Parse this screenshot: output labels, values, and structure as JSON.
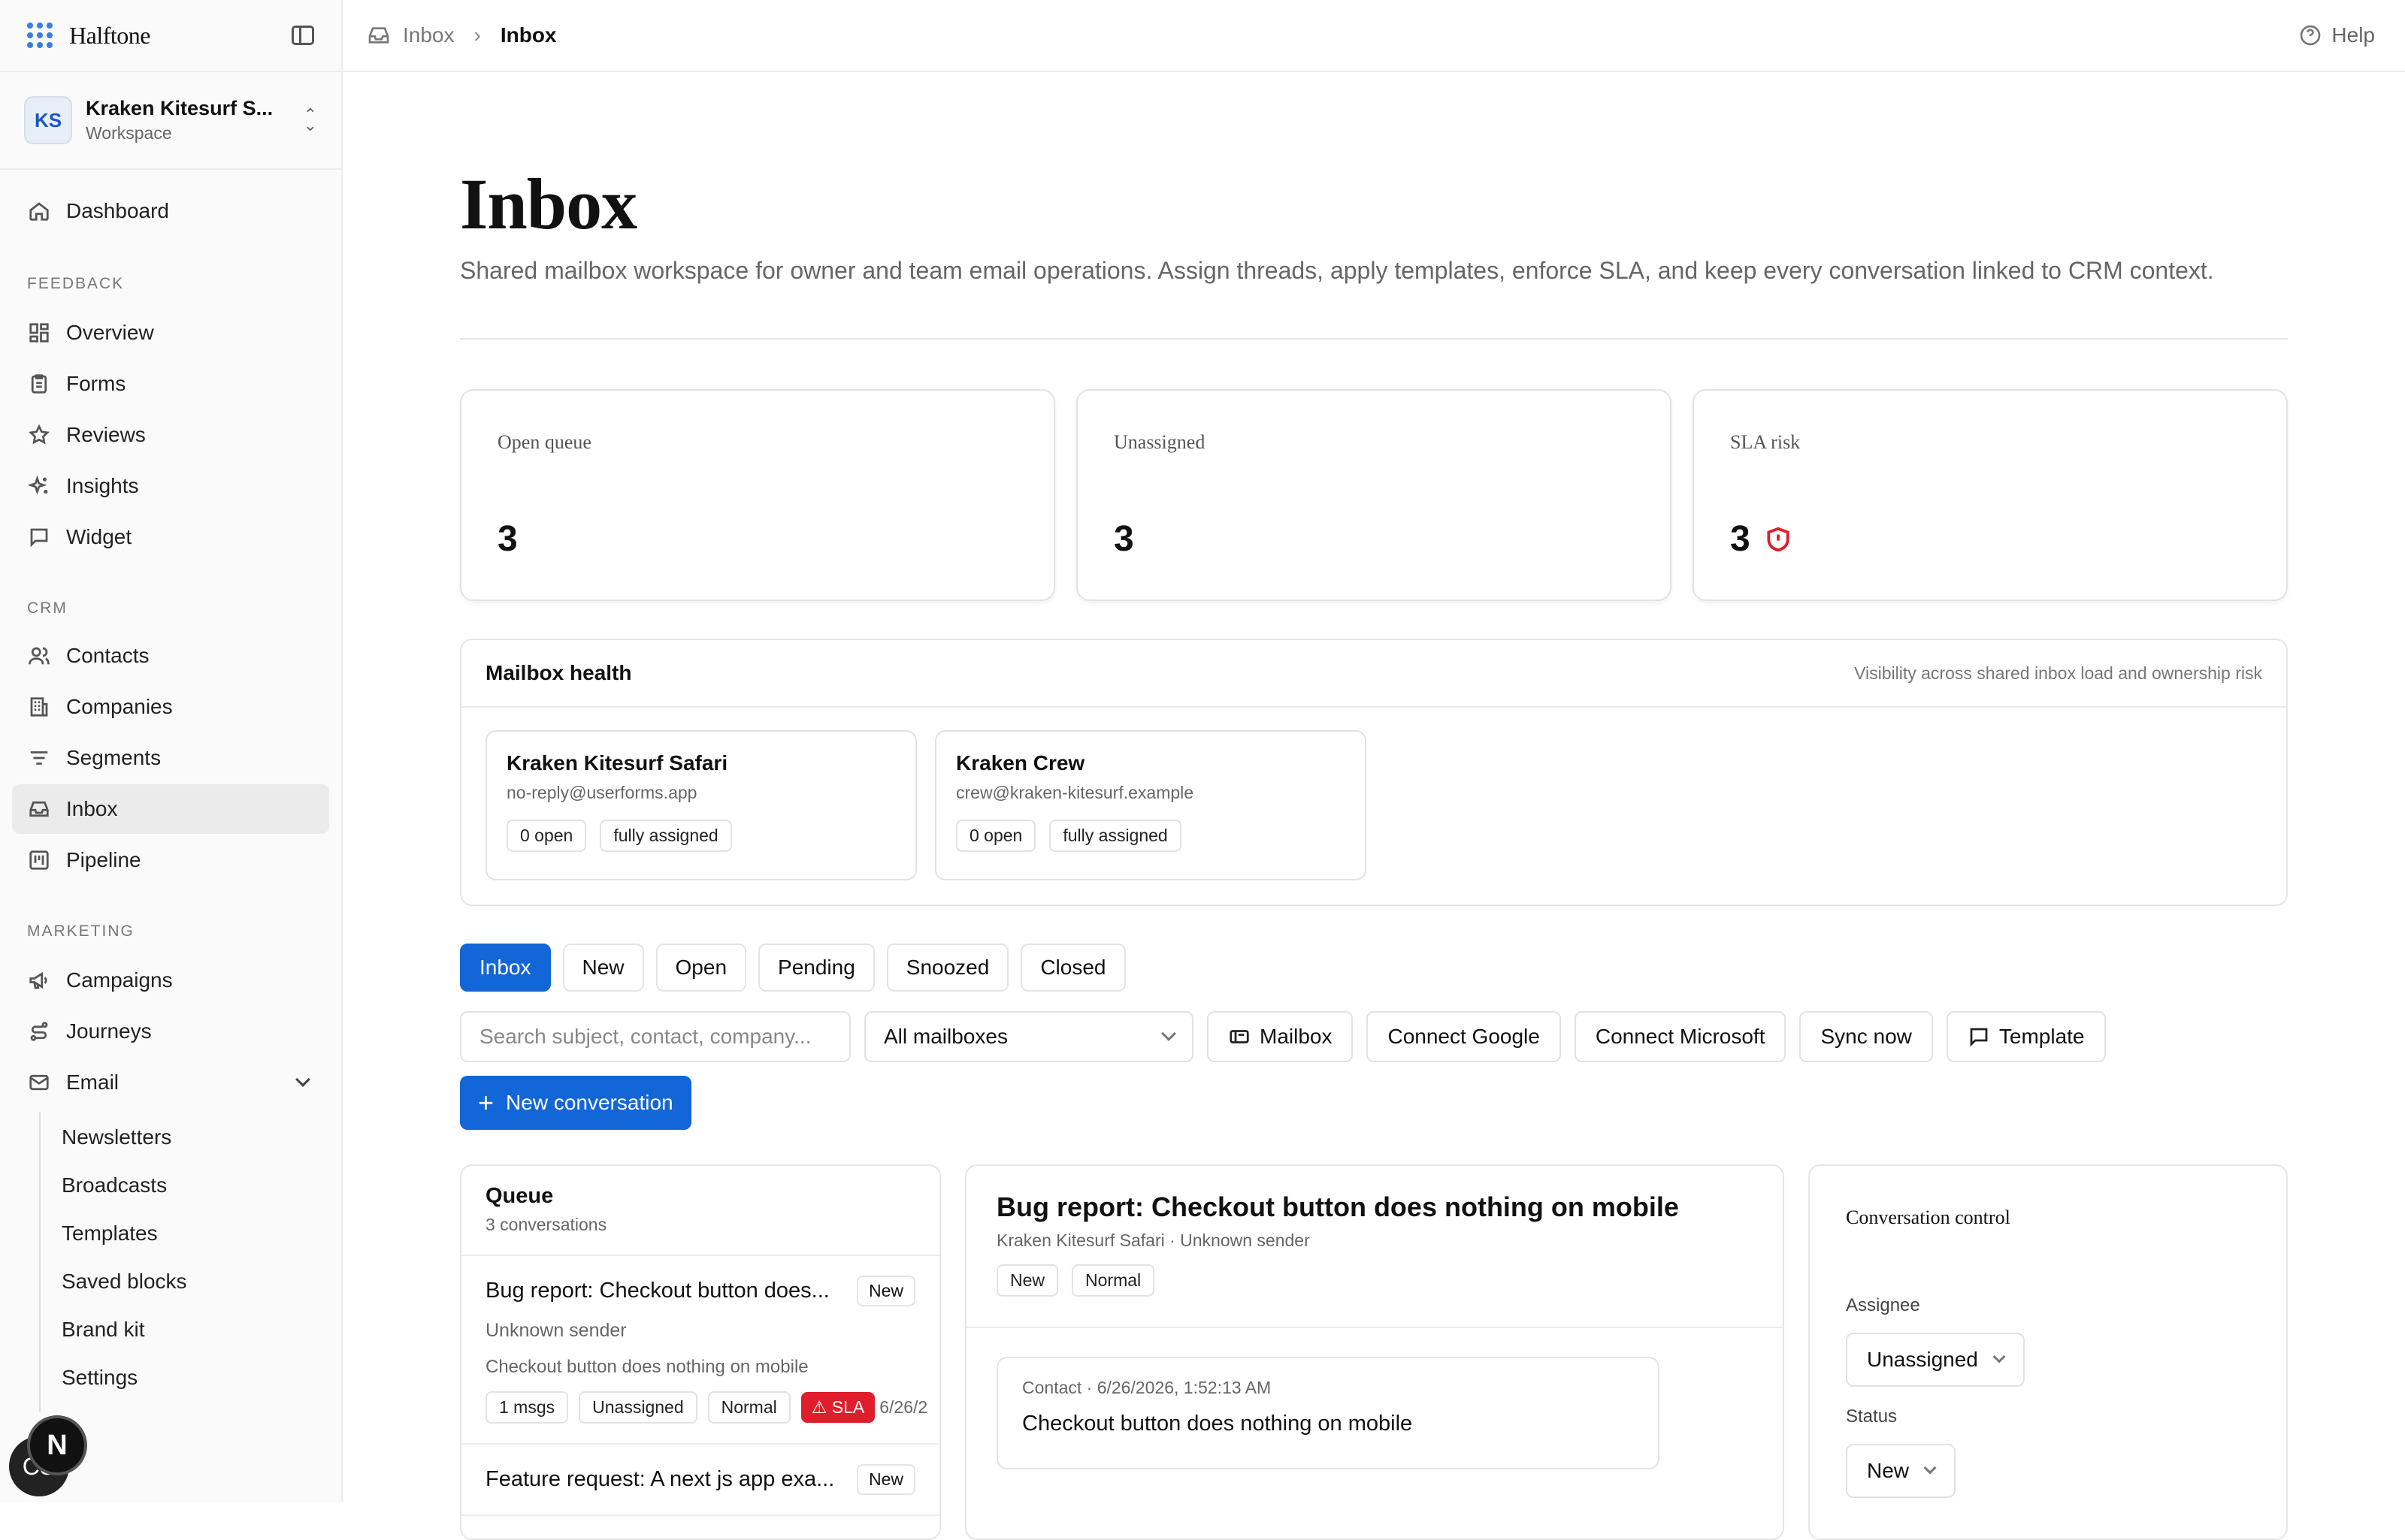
{
  "app": {
    "name": "Halftone",
    "help_label": "Help"
  },
  "workspace": {
    "initials": "KS",
    "name": "Kraken Kitesurf S...",
    "sub": "Workspace"
  },
  "sidebar": {
    "dashboard": "Dashboard",
    "sections": {
      "feedback": "FEEDBACK",
      "crm": "CRM",
      "marketing": "MARKETING"
    },
    "items": [
      {
        "label": "Overview"
      },
      {
        "label": "Forms"
      },
      {
        "label": "Reviews"
      },
      {
        "label": "Insights"
      },
      {
        "label": "Widget"
      },
      {
        "label": "Contacts"
      },
      {
        "label": "Companies"
      },
      {
        "label": "Segments"
      },
      {
        "label": "Inbox"
      },
      {
        "label": "Pipeline"
      },
      {
        "label": "Campaigns"
      },
      {
        "label": "Journeys"
      },
      {
        "label": "Email"
      }
    ],
    "email_sub": [
      "Newsletters",
      "Broadcasts",
      "Templates",
      "Saved blocks",
      "Brand kit",
      "Settings"
    ],
    "fab_label": "N",
    "fab_behind_label": "CS"
  },
  "breadcrumb": {
    "root": "Inbox",
    "current": "Inbox"
  },
  "page": {
    "title": "Inbox",
    "subtitle": "Shared mailbox workspace for owner and team email operations. Assign threads, apply templates, enforce SLA, and keep every conversation linked to CRM context."
  },
  "stats": [
    {
      "label": "Open queue",
      "value": "3"
    },
    {
      "label": "Unassigned",
      "value": "3"
    },
    {
      "label": "SLA risk",
      "value": "3"
    }
  ],
  "health": {
    "title": "Mailbox health",
    "note": "Visibility across shared inbox load and ownership risk",
    "mailboxes": [
      {
        "name": "Kraken Kitesurf Safari",
        "email": "no-reply@userforms.app",
        "open": "0 open",
        "status": "fully assigned"
      },
      {
        "name": "Kraken Crew",
        "email": "crew@kraken-kitesurf.example",
        "open": "0 open",
        "status": "fully assigned"
      }
    ]
  },
  "tabs": [
    "Inbox",
    "New",
    "Open",
    "Pending",
    "Snoozed",
    "Closed"
  ],
  "tools": {
    "search_placeholder": "Search subject, contact, company...",
    "mailbox_select": "All mailboxes",
    "mailbox_btn": "Mailbox",
    "google_btn": "Connect Google",
    "microsoft_btn": "Connect Microsoft",
    "sync_btn": "Sync now",
    "template_btn": "Template",
    "new_conversation": "New conversation"
  },
  "queue": {
    "title": "Queue",
    "count": "3 conversations",
    "items": [
      {
        "subject": "Bug report: Checkout button does...",
        "badge": "New",
        "from": "Unknown sender",
        "preview": "Checkout button does nothing on mobile",
        "msgs": "1 msgs",
        "assignee": "Unassigned",
        "priority": "Normal",
        "sla": "SLA",
        "date": "6/26/2"
      },
      {
        "subject": "Feature request: A next js app exa...",
        "badge": "New"
      }
    ]
  },
  "detail": {
    "title": "Bug report: Checkout button does nothing on mobile",
    "meta": "Kraken Kitesurf Safari · Unknown sender",
    "status": "New",
    "priority": "Normal",
    "message": {
      "meta": "Contact · 6/26/2026, 1:52:13 AM",
      "body": "Checkout button does nothing on mobile"
    }
  },
  "control": {
    "title": "Conversation control",
    "assignee_label": "Assignee",
    "assignee_value": "Unassigned",
    "status_label": "Status",
    "status_value": "New"
  },
  "colors": {
    "accent": "#1266d8",
    "danger": "#e01e2b"
  }
}
